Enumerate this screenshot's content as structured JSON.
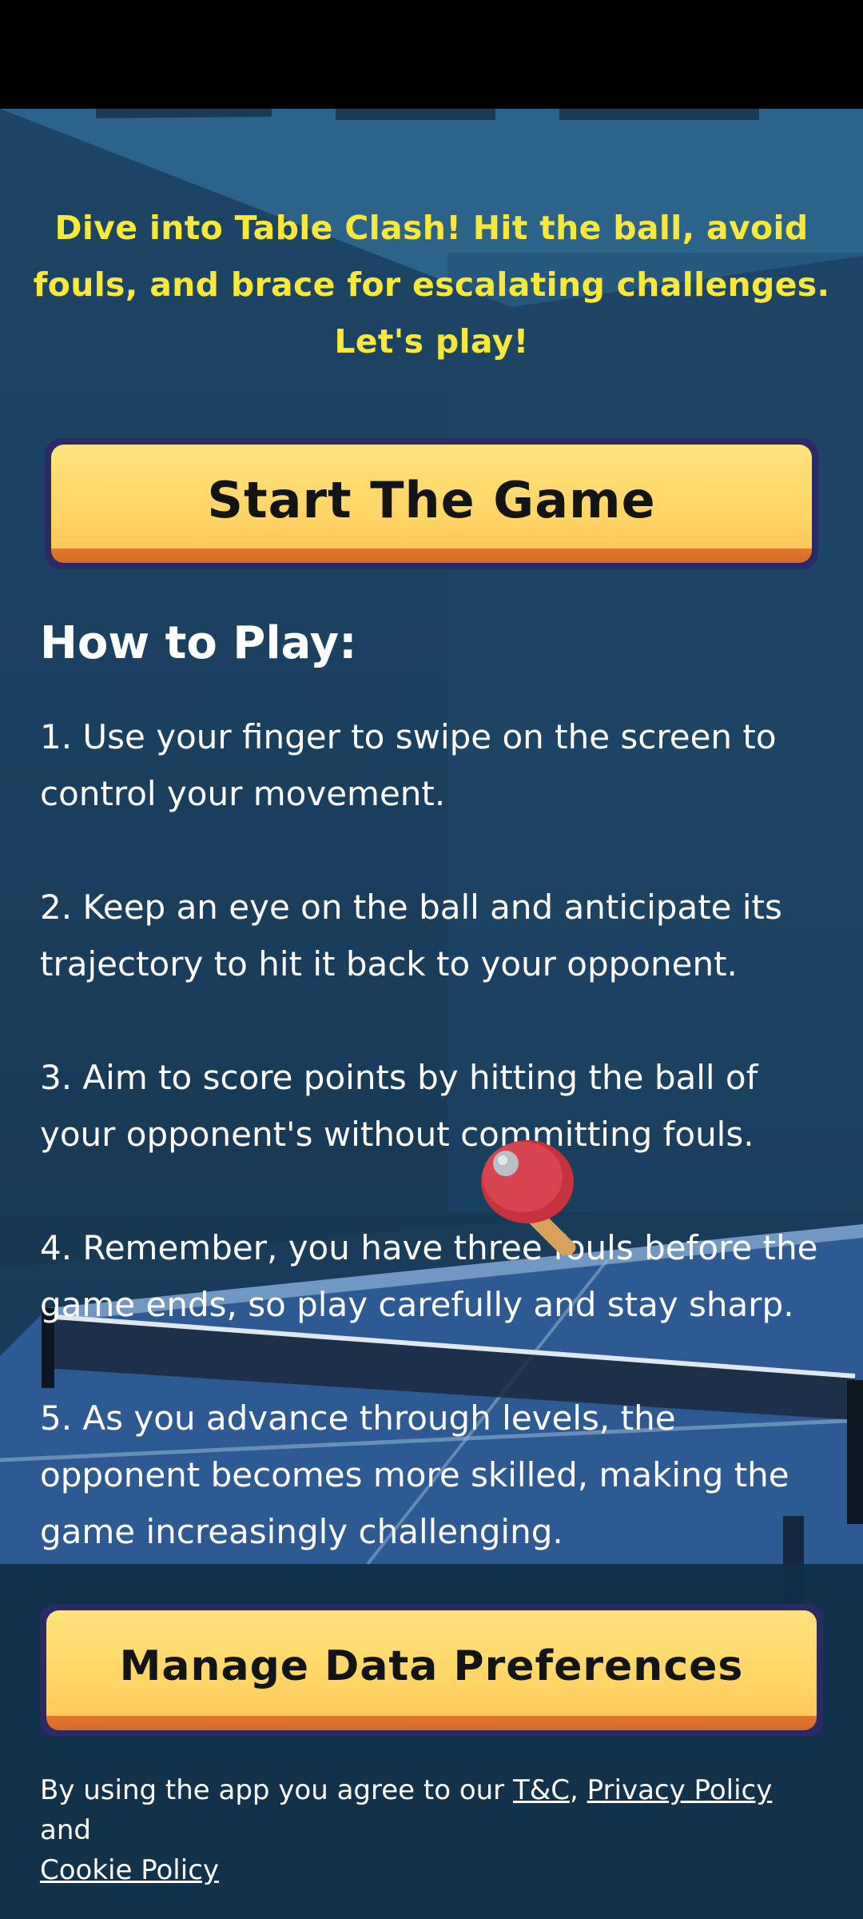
{
  "intro_text": "Dive into Table Clash! Hit the ball, avoid fouls, and brace for escalating challenges. Let's play!",
  "start_button_label": "Start The Game",
  "how_to_play": {
    "title": "How to Play:",
    "steps": [
      "1. Use your finger to swipe on the screen to control your movement.",
      "2. Keep an eye on the ball and anticipate its trajectory to hit it back to your opponent.",
      "3. Aim to score points by hitting the ball of your opponent's without committing fouls.",
      "4. Remember, you have three fouls before the game ends, so play carefully and stay sharp.",
      "5. As you advance through levels, the opponent becomes more skilled, making the game increasingly challenging."
    ]
  },
  "manage_button_label": "Manage Data Preferences",
  "legal": {
    "prefix": "By using the app you agree to our ",
    "tc_link": "T&C",
    "sep": ", ",
    "privacy_link": "Privacy Policy ",
    "and": "and",
    "cookie_link": "Cookie Policy"
  },
  "icons": {
    "paddle": "ping-pong-paddle-icon"
  },
  "colors": {
    "intro_text": "#f7e83a",
    "button_face": "#ffd565",
    "button_border": "#2a2a66",
    "background": "#14324d"
  }
}
